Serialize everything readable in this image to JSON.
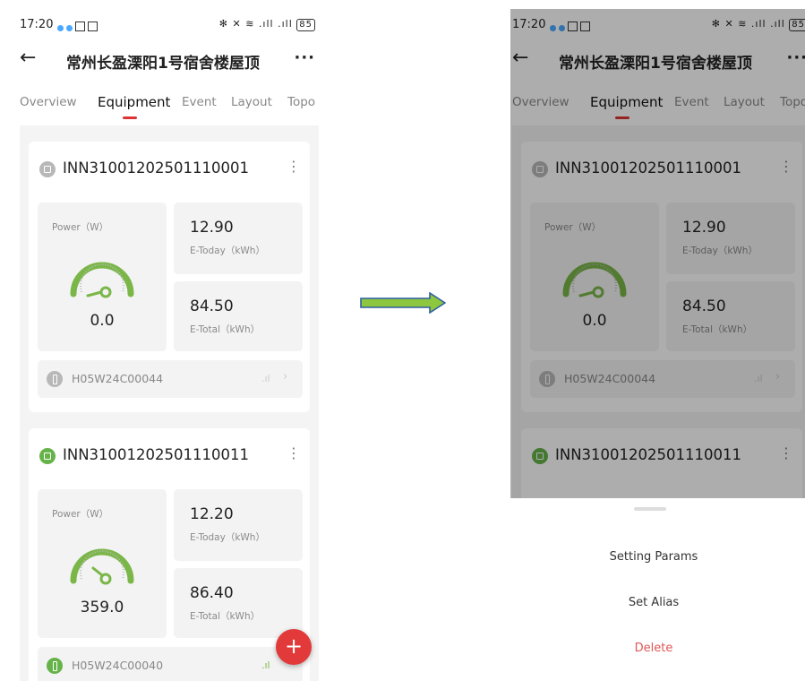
{
  "status_bar": {
    "time": "17:20",
    "network": "✻ ✕ ≋ .ıll .ıll",
    "battery": "85"
  },
  "header": {
    "title": "常州长盈溧阳1号宿舍楼屋顶"
  },
  "tabs": [
    {
      "label": "Overview"
    },
    {
      "label": "Equipment"
    },
    {
      "label": "Event"
    },
    {
      "label": "Layout"
    },
    {
      "label": "Topolc"
    }
  ],
  "devices": [
    {
      "serial": "INN31001202501110001",
      "power_label": "Power（W）",
      "power_value": "0.0",
      "e_today": "12.90",
      "e_today_label": "E-Today（kWh）",
      "e_total": "84.50",
      "e_total_label": "E-Total（kWh）",
      "datalogger": "H05W24C00044",
      "online": false
    },
    {
      "serial": "INN31001202501110011",
      "power_label": "Power（W）",
      "power_value": "359.0",
      "e_today": "12.20",
      "e_today_label": "E-Today（kWh）",
      "e_total": "86.40",
      "e_total_label": "E-Total（kWh）",
      "datalogger": "H05W24C00040",
      "online": true
    }
  ],
  "fab": {
    "label": "+"
  },
  "action_sheet": {
    "options": [
      {
        "label": "Setting Params"
      },
      {
        "label": "Set Alias"
      },
      {
        "label": "Delete"
      }
    ]
  },
  "colors": {
    "accent": "#d33333",
    "gauge_green": "#7ab648",
    "online_green": "#66b34a",
    "overlay": "#000000"
  }
}
